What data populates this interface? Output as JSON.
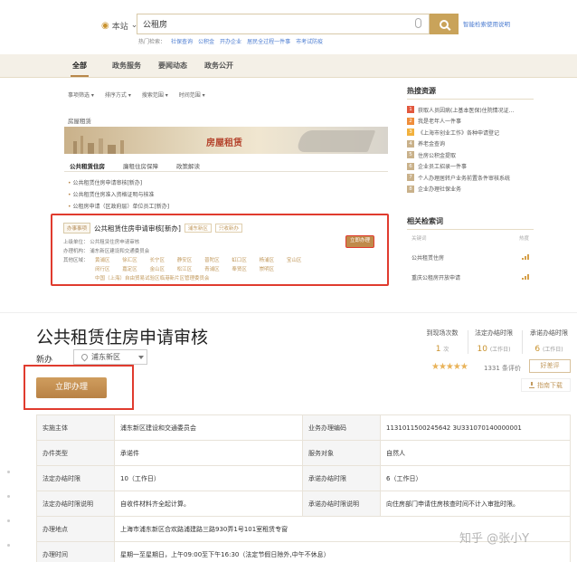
{
  "search": {
    "scope": "本站",
    "query": "公租房",
    "link": "智能检索使用说明",
    "hot_label": "热门检索：",
    "hot_items": [
      "社保查询",
      "公积金",
      "开办企业",
      "居民全过程一件事",
      "市考试防疫"
    ]
  },
  "tabs": [
    "全部",
    "政务服务",
    "要闻动态",
    "政务公开"
  ],
  "filters": [
    "事项筛选 ▾",
    "排序方式 ▾",
    "搜索范围 ▾",
    "时间范围 ▾"
  ],
  "section_title": "房屋租赁",
  "banner_title": "房屋租赁",
  "subtabs": [
    "公共租赁住房",
    "廉租住房保障",
    "政策解读"
  ],
  "policy_list": [
    "公共租赁住房申请审核[新办]",
    "公共租赁住房准入资格证明与核准",
    "公租房申请（区政府层）单位员工[新办]"
  ],
  "result": {
    "badge": "办事事项",
    "title": "公共租赁住房申请审核[新办]",
    "tags": [
      "浦东新区",
      "只收新办"
    ],
    "dept": "上级单位：  公共租赁住房申请审核",
    "org": "办理机构：  浦东新区建设和交通委员会",
    "district_label": "其他区域：",
    "districts_row1": [
      "黄浦区",
      "徐汇区",
      "长宁区",
      "静安区",
      "普陀区",
      "虹口区",
      "杨浦区",
      "宝山区"
    ],
    "districts_row2": [
      "闵行区",
      "嘉定区",
      "金山区",
      "松江区",
      "青浦区",
      "奉贤区",
      "崇明区"
    ],
    "districts_row3": "中国（上海）自由贸易试验区临港新片区管理委员会",
    "apply_label": "立即办理"
  },
  "sidebar": {
    "hot_title": "热搜资源",
    "hot_list": [
      "获取人员因病(上基本医保)住院情况证...",
      "我是老年人一件事",
      "《上海市创业工作》各种申请登记",
      "养老金查询",
      "住房公积金提取",
      "企业员工招录一件事",
      "个人办理居转户业务前置条件审核系统",
      "企业办理社保业务"
    ],
    "related_title": "相关检索词",
    "col_term": "关键词",
    "col_heat": "热度",
    "related": [
      "公共租赁住房",
      "重庆公租房开放申请"
    ]
  },
  "detail": {
    "title": "公共租赁住房申请审核",
    "type_label": "新办",
    "region": "浦东新区",
    "apply_label": "立即办理",
    "stats": [
      {
        "label": "到现场次数",
        "value": "1",
        "unit": "次"
      },
      {
        "label": "法定办结时限",
        "value": "10",
        "unit": "(工作日)"
      },
      {
        "label": "承诺办结时限",
        "value": "6",
        "unit": "(工作日)"
      }
    ],
    "stars": "★★★★★",
    "score": "1331 条评价",
    "praise_label": "好差评",
    "guide_label": "指南下载"
  },
  "info": {
    "impl_subject_k": "实施主体",
    "impl_subject_v": "浦东新区建设和交通委员会",
    "code_k": "业务办理编码",
    "code_v": "1131011500245642 3U331070140000001",
    "type_k": "办件类型",
    "type_v": "承诺件",
    "target_k": "服务对象",
    "target_v": "自然人",
    "legal_k": "法定办结时限",
    "legal_v": "10（工作日）",
    "promise_k": "承诺办结时限",
    "promise_v": "6（工作日）",
    "legal_desc_k": "法定办结时限说明",
    "legal_desc_v": "自收件材料齐全起计算。",
    "promise_desc_k": "承诺办结时限说明",
    "promise_desc_v": "向住房部门申请住房核查时间不计入审批时限。",
    "addr_k": "办理地点",
    "addr_v": "上海市浦东新区合欢路浦建路三路930弄1号101室租赁专窗",
    "time_k": "办理时间",
    "time_v": "星期一至星期日，上午09:00至下午16:30（法定节假日除外,中午不休息）"
  },
  "watermark": "知乎 @张小Y"
}
